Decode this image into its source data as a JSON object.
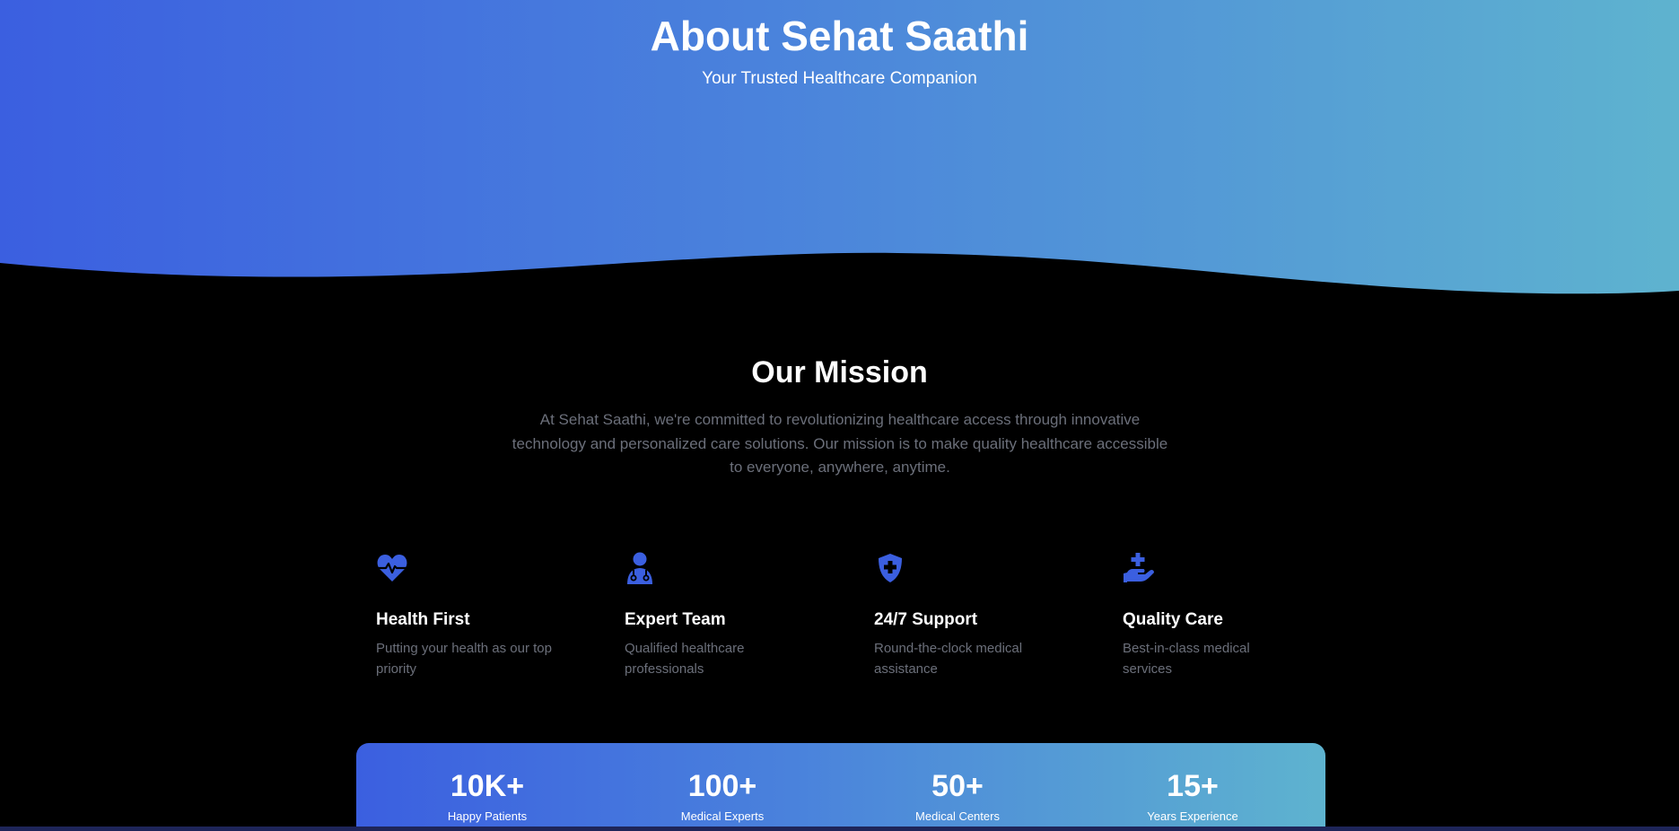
{
  "hero": {
    "title": "About Sehat Saathi",
    "subtitle": "Your Trusted Healthcare Companion"
  },
  "mission": {
    "title": "Our Mission",
    "text": "At Sehat Saathi, we're committed to revolutionizing healthcare access through innovative technology and personalized care solutions. Our mission is to make quality healthcare accessible to everyone, anywhere, anytime."
  },
  "features": [
    {
      "icon": "heart-pulse-icon",
      "title": "Health First",
      "description": "Putting your health as our top priority"
    },
    {
      "icon": "doctor-icon",
      "title": "Expert Team",
      "description": "Qualified healthcare professionals"
    },
    {
      "icon": "shield-cross-icon",
      "title": "24/7 Support",
      "description": "Round-the-clock medical assistance"
    },
    {
      "icon": "hand-medical-icon",
      "title": "Quality Care",
      "description": "Best-in-class medical services"
    }
  ],
  "stats": [
    {
      "value": "10K+",
      "label": "Happy Patients"
    },
    {
      "value": "100+",
      "label": "Medical Experts"
    },
    {
      "value": "50+",
      "label": "Medical Centers"
    },
    {
      "value": "15+",
      "label": "Years Experience"
    }
  ],
  "colors": {
    "accent": "#3b5fe0",
    "gradient_start": "#3b5fe0",
    "gradient_end": "#5eb3cf",
    "background": "#000000",
    "muted_text": "#6b6f7a"
  }
}
